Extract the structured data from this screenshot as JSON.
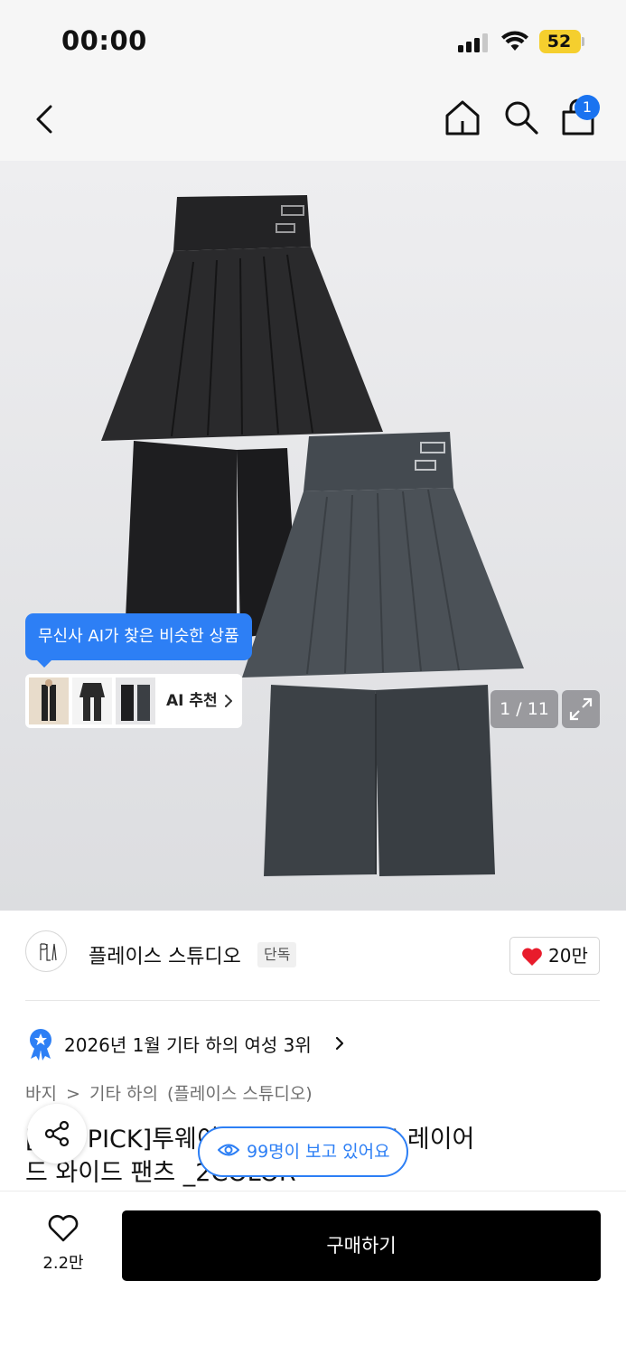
{
  "status": {
    "time": "00:00",
    "battery": "52"
  },
  "nav": {
    "cart_count": "1"
  },
  "gallery": {
    "ai_bubble": "무신사 AI가 찾은 비슷한 상품",
    "ai_card_label": "AI 추천",
    "counter": "1 / 11"
  },
  "brand": {
    "name": "플레이스 스튜디오",
    "tag": "단독",
    "likes": "20만"
  },
  "ranking": {
    "text": "2026년 1월 기타 하의 여성 3위"
  },
  "breadcrumb": {
    "items": [
      "바지",
      ">",
      "기타 하의",
      "(플레이스 스튜디오)"
    ]
  },
  "product": {
    "title_line1": "[오늘 PICK]투웨이 플리츠 랩 스커트 레이어",
    "title_line2": "드 와이드 팬츠 _2COLOR",
    "viewers": "99명이 보고 있어요"
  },
  "bottom": {
    "wish_count": "2.2만",
    "buy_label": "구매하기"
  },
  "colors": {
    "accent_blue": "#2d7ff5",
    "badge_blue": "#1a73f0",
    "battery_yellow": "#f5cf2e",
    "heart_red": "#e81c2c",
    "buy_black": "#000000"
  }
}
